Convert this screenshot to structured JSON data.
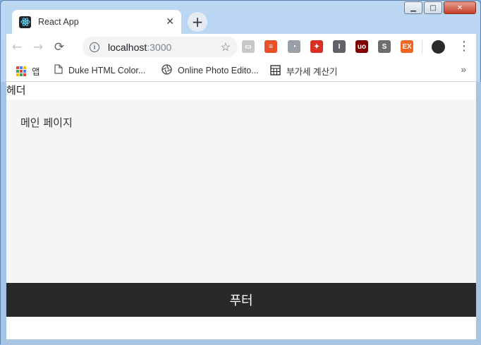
{
  "tab": {
    "title": "React App",
    "close": "✕"
  },
  "newtab": "+",
  "nav": {
    "back": "←",
    "forward": "→",
    "reload": "⟳"
  },
  "omnibox": {
    "host": "localhost",
    "port": ":3000",
    "info": "i",
    "star": "☆"
  },
  "extensions": [
    {
      "name": "cast-icon",
      "color": "#c6c9cc",
      "glyph": "▭"
    },
    {
      "name": "reader-ext-icon",
      "color": "#e8502a",
      "glyph": "≡"
    },
    {
      "name": "ghost-ext-icon",
      "color": "#9aa0a6",
      "glyph": "◔"
    },
    {
      "name": "puzzle-ext-icon",
      "color": "#d93025",
      "glyph": "✦"
    },
    {
      "name": "i-ext-icon",
      "color": "#5f6368",
      "glyph": "I"
    },
    {
      "name": "ublock-icon",
      "color": "#800000",
      "glyph": "uo"
    },
    {
      "name": "s-ext-icon",
      "color": "#6d6d6d",
      "glyph": "S"
    },
    {
      "name": "ex-ext-icon",
      "color": "#f26522",
      "glyph": "EX"
    }
  ],
  "bookmarks": {
    "apps": "앱",
    "items": [
      {
        "label": "Duke HTML Color..."
      },
      {
        "label": "Online Photo Edito..."
      },
      {
        "label": "부가세 계산기"
      }
    ],
    "more": "»"
  },
  "page": {
    "header": "헤더",
    "main": "메인 페이지",
    "footer": "푸터"
  }
}
